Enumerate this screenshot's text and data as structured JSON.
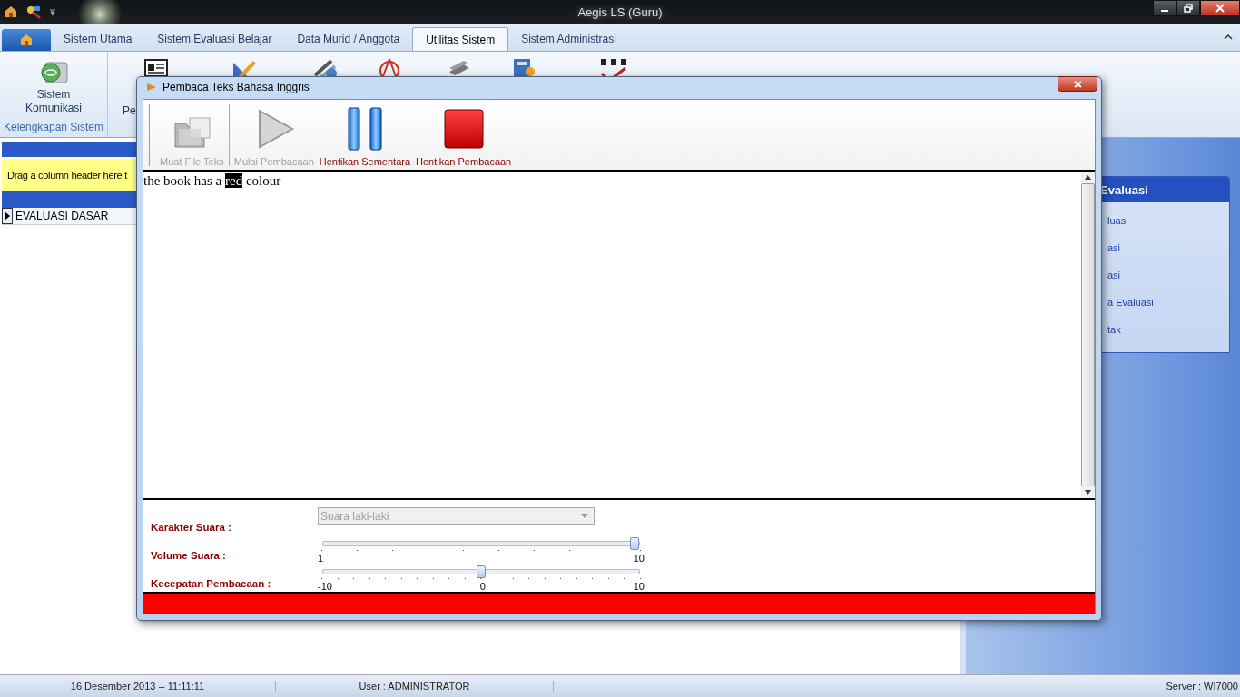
{
  "window": {
    "title": "Aegis LS (Guru)"
  },
  "ribbon": {
    "tabs": [
      {
        "label": "Sistem Utama",
        "selected": false
      },
      {
        "label": "Sistem Evaluasi Belajar",
        "selected": false
      },
      {
        "label": "Data Murid / Anggota",
        "selected": false
      },
      {
        "label": "Utilitas Sistem",
        "selected": true
      },
      {
        "label": "Sistem Administrasi",
        "selected": false
      }
    ],
    "group": {
      "button": "Sistem Komunikasi",
      "label": "Kelengkapan Sistem"
    },
    "partial_label": "Pe"
  },
  "grid": {
    "group_panel_hint": "Drag a column header here t",
    "rows": [
      {
        "cells": [
          "EVALUASI DASAR"
        ],
        "selected": true
      }
    ]
  },
  "task_pane": {
    "title": "Evaluasi",
    "items": [
      "luasi",
      "asi",
      "asi",
      "a Evaluasi",
      "tak"
    ]
  },
  "dialog": {
    "title": "Pembaca Teks Bahasa Inggris",
    "toolbar": [
      {
        "label": "Muat File Teks",
        "kind": "open",
        "disabled": true
      },
      {
        "label": "Mulai Pembacaan",
        "kind": "play",
        "disabled": true
      },
      {
        "label": "Hentikan Sementara",
        "kind": "pause",
        "disabled": false
      },
      {
        "label": "Hentikan Pembacaan",
        "kind": "stop",
        "disabled": false
      }
    ],
    "text": [
      {
        "text": "the book has a ",
        "highlighted": false
      },
      {
        "text": "red",
        "highlighted": true
      },
      {
        "text": " colour",
        "highlighted": false
      }
    ],
    "settings": [
      {
        "kind": "dropdown",
        "label": "Karakter Suara :",
        "value": "Suara laki-laki",
        "disabled": true
      },
      {
        "kind": "slider",
        "label": "Volume Suara :",
        "level": 1,
        "tick_labels": [
          "1",
          "10"
        ]
      },
      {
        "kind": "slider",
        "label": "Kecepatan Pembacaan :",
        "level": 0.5,
        "tick_labels": [
          "-10",
          "0",
          "10"
        ]
      }
    ],
    "progress": {
      "level": 1
    }
  },
  "status_bar": {
    "date": "16 Desember 2013 -- 11:11:11",
    "user": "User : ADMINISTRATOR",
    "server": "Server : WI7000"
  }
}
